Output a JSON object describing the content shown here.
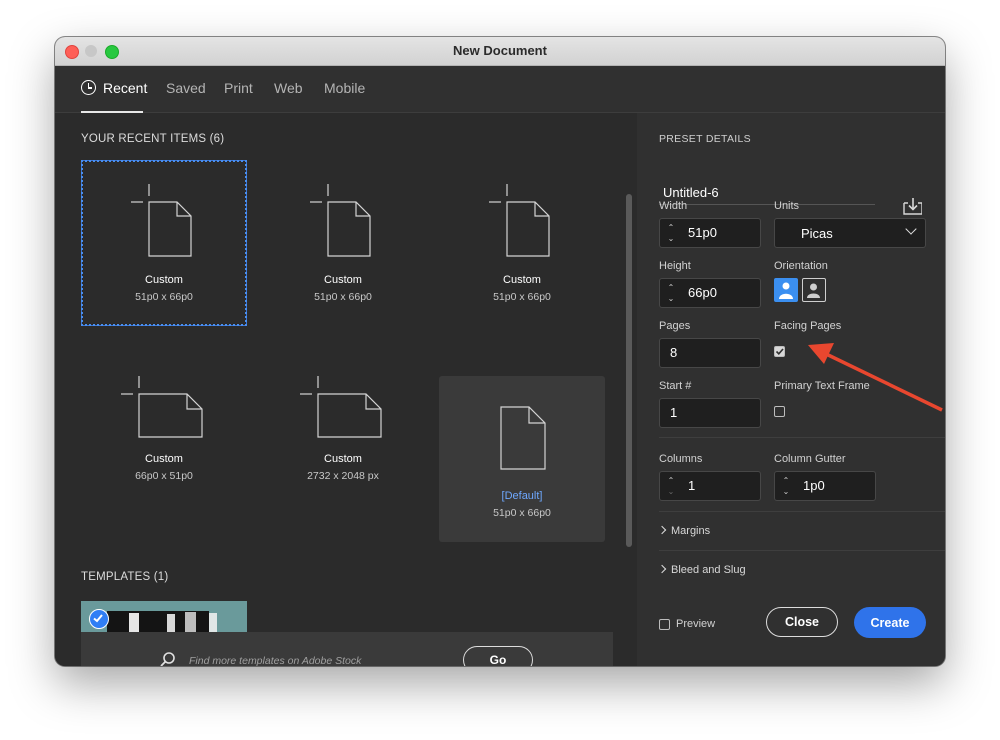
{
  "window": {
    "title": "New Document"
  },
  "tabs": [
    {
      "label": "Recent",
      "active": true
    },
    {
      "label": "Saved"
    },
    {
      "label": "Print"
    },
    {
      "label": "Web"
    },
    {
      "label": "Mobile"
    }
  ],
  "recent": {
    "title": "YOUR RECENT ITEMS",
    "count": "(6)",
    "items": [
      {
        "name": "Custom",
        "size": "51p0 x 66p0",
        "orientation": "portrait",
        "selected": true
      },
      {
        "name": "Custom",
        "size": "51p0 x 66p0",
        "orientation": "portrait"
      },
      {
        "name": "Custom",
        "size": "51p0 x 66p0",
        "orientation": "portrait"
      },
      {
        "name": "Custom",
        "size": "66p0 x 51p0",
        "orientation": "landscape"
      },
      {
        "name": "Custom",
        "size": "2732 x 2048 px",
        "orientation": "landscape"
      },
      {
        "name": "[Default]",
        "size": "51p0 x 66p0",
        "orientation": "portrait",
        "is_default": true
      }
    ]
  },
  "templates": {
    "title": "TEMPLATES",
    "count": "(1)"
  },
  "search": {
    "placeholder": "Find more templates on Adobe Stock",
    "go_label": "Go"
  },
  "preset": {
    "header": "PRESET DETAILS",
    "name": "Untitled-6",
    "width_label": "Width",
    "width": "51p0",
    "units_label": "Units",
    "units": "Picas",
    "height_label": "Height",
    "height": "66p0",
    "orientation_label": "Orientation",
    "orientation": "portrait",
    "pages_label": "Pages",
    "pages": "8",
    "facing_pages_label": "Facing Pages",
    "facing_pages": true,
    "start_label": "Start #",
    "start": "1",
    "primary_text_frame_label": "Primary Text Frame",
    "primary_text_frame": false,
    "columns_label": "Columns",
    "columns": "1",
    "column_gutter_label": "Column Gutter",
    "column_gutter": "1p0",
    "margins_label": "Margins",
    "bleed_label": "Bleed and Slug"
  },
  "footer": {
    "preview_label": "Preview",
    "close_label": "Close",
    "create_label": "Create"
  },
  "colors": {
    "accent": "#2f73ea",
    "annotation_arrow": "#e8472f"
  }
}
